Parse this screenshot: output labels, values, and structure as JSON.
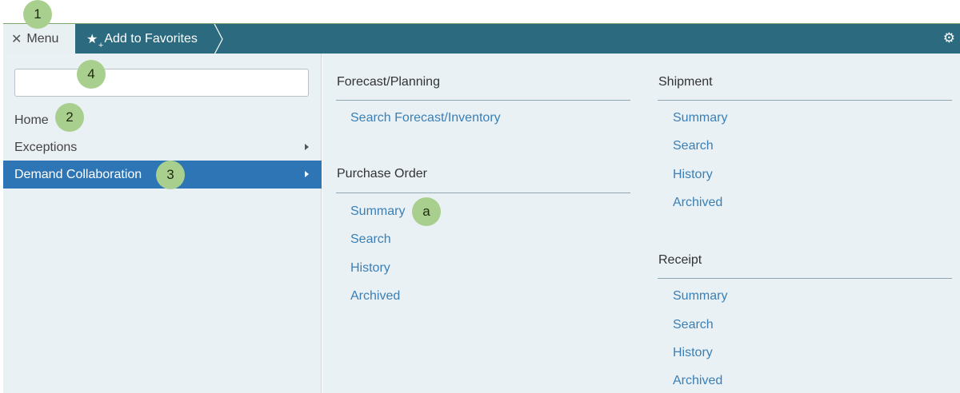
{
  "callouts": {
    "c1": "1",
    "c2": "2",
    "c3": "3",
    "c4": "4",
    "ca": "a"
  },
  "topbar": {
    "menu_label": "Menu",
    "close_glyph": "✕",
    "favorites_label": "Add to Favorites",
    "favorites_icon": "star-plus-icon",
    "settings_icon": "gear-icon"
  },
  "search": {
    "value": "",
    "placeholder": ""
  },
  "nav": {
    "items": [
      {
        "label": "Home"
      },
      {
        "label": "Exceptions"
      },
      {
        "label": "Demand Collaboration"
      }
    ]
  },
  "sections": {
    "forecast": {
      "title": "Forecast/Planning",
      "links": [
        "Search Forecast/Inventory"
      ]
    },
    "purchase_order": {
      "title": "Purchase Order",
      "links": [
        "Summary",
        "Search",
        "History",
        "Archived"
      ]
    },
    "shipment": {
      "title": "Shipment",
      "links": [
        "Summary",
        "Search",
        "History",
        "Archived"
      ]
    },
    "receipt": {
      "title": "Receipt",
      "links": [
        "Summary",
        "Search",
        "History",
        "Archived"
      ]
    }
  },
  "colors": {
    "topbar": "#2b6a7f",
    "active_nav": "#2e75b5",
    "link": "#3b7fb5",
    "callout": "#a9cf8e"
  }
}
